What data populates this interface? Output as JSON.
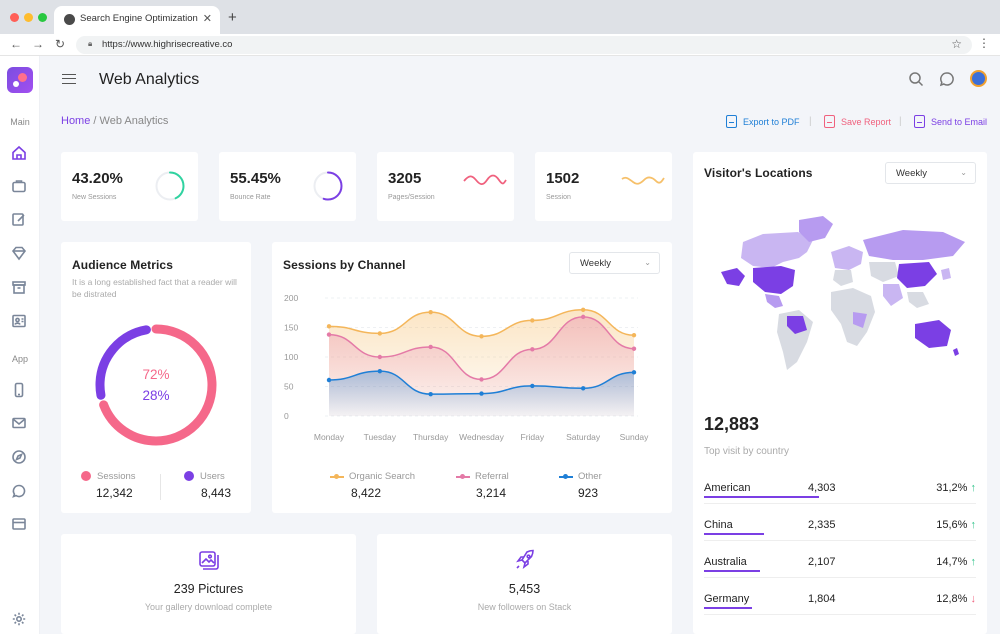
{
  "browser": {
    "tab_title": "Search Engine Optimization",
    "url": "https://www.highrisecreative.co"
  },
  "sidebar": {
    "section_main": "Main",
    "section_app": "App",
    "main_icons": [
      "home-icon",
      "briefcase-icon",
      "edit-icon",
      "diamond-icon",
      "archive-icon",
      "contacts-icon"
    ],
    "app_icons": [
      "phone-icon",
      "mail-icon",
      "compass-icon",
      "chat-icon",
      "card-icon"
    ],
    "bottom_icon": "settings-icon"
  },
  "header": {
    "title": "Web Analytics"
  },
  "breadcrumb": {
    "home": "Home",
    "separator": " / ",
    "current": "Web Analytics"
  },
  "actions": {
    "export_pdf": "Export to PDF",
    "save_report": "Save Report",
    "send_email": "Send to Email"
  },
  "kpis": [
    {
      "value": "43.20%",
      "label": "New Sessions",
      "progress": 0.43,
      "color": "#2fd3a0"
    },
    {
      "value": "55.45%",
      "label": "Bounce Rate",
      "progress": 0.55,
      "color": "#7b3fe4"
    },
    {
      "value": "3205",
      "label": "Pages/Session",
      "color": "#f0617e"
    },
    {
      "value": "1502",
      "label": "Session",
      "color": "#f6c06a"
    }
  ],
  "audience": {
    "title": "Audience Metrics",
    "description": "It is a long established fact that a reader will be distrated",
    "pct_sessions": "72%",
    "pct_users": "28%",
    "sessions_fraction": 0.72,
    "sessions_label": "Sessions",
    "sessions_value": "12,342",
    "users_label": "Users",
    "users_value": "8,443",
    "sessions_color": "#f5688a",
    "users_color": "#7b3fe4"
  },
  "channel": {
    "title": "Sessions by Channel",
    "filter": "Weekly",
    "legend": [
      {
        "label": "Organic Search",
        "value": "8,422",
        "color": "#f4b65a"
      },
      {
        "label": "Referral",
        "value": "3,214",
        "color": "#e47aa7"
      },
      {
        "label": "Other",
        "value": "923",
        "color": "#1f7fd6"
      }
    ]
  },
  "chart_data": {
    "type": "line",
    "title": "Sessions by Channel",
    "x": [
      "Monday",
      "Tuesday",
      "Thursday",
      "Wednesday",
      "Friday",
      "Saturday",
      "Sunday"
    ],
    "ylim": [
      0,
      200
    ],
    "yticks": [
      0,
      50,
      100,
      150,
      200
    ],
    "grid": true,
    "series": [
      {
        "name": "Organic Search",
        "values": [
          152,
          140,
          176,
          135,
          162,
          180,
          137
        ]
      },
      {
        "name": "Referral",
        "values": [
          138,
          100,
          117,
          62,
          113,
          168,
          114
        ]
      },
      {
        "name": "Other",
        "values": [
          61,
          76,
          37,
          38,
          51,
          47,
          74
        ]
      }
    ]
  },
  "locations": {
    "title": "Visitor's Locations",
    "filter": "Weekly",
    "total": "12,883",
    "subtitle": "Top visit by country",
    "rows": [
      {
        "name": "American",
        "count": "4,303",
        "pct": "31,2%",
        "trend": "up",
        "share": 0.31
      },
      {
        "name": "China",
        "count": "2,335",
        "pct": "15,6%",
        "trend": "up",
        "share": 0.16
      },
      {
        "name": "Australia",
        "count": "2,107",
        "pct": "14,7%",
        "trend": "up",
        "share": 0.15
      },
      {
        "name": "Germany",
        "count": "1,804",
        "pct": "12,8%",
        "trend": "down",
        "share": 0.13
      }
    ]
  },
  "bottom_cards": [
    {
      "icon": "gallery-icon",
      "title": "239 Pictures",
      "subtitle": "Your gallery download complete"
    },
    {
      "icon": "rocket-icon",
      "title": "5,453",
      "subtitle": "New followers on Stack"
    }
  ],
  "colors": {
    "accent": "#7b3fe4",
    "up": "#2fc38a",
    "down": "#f0617e"
  }
}
